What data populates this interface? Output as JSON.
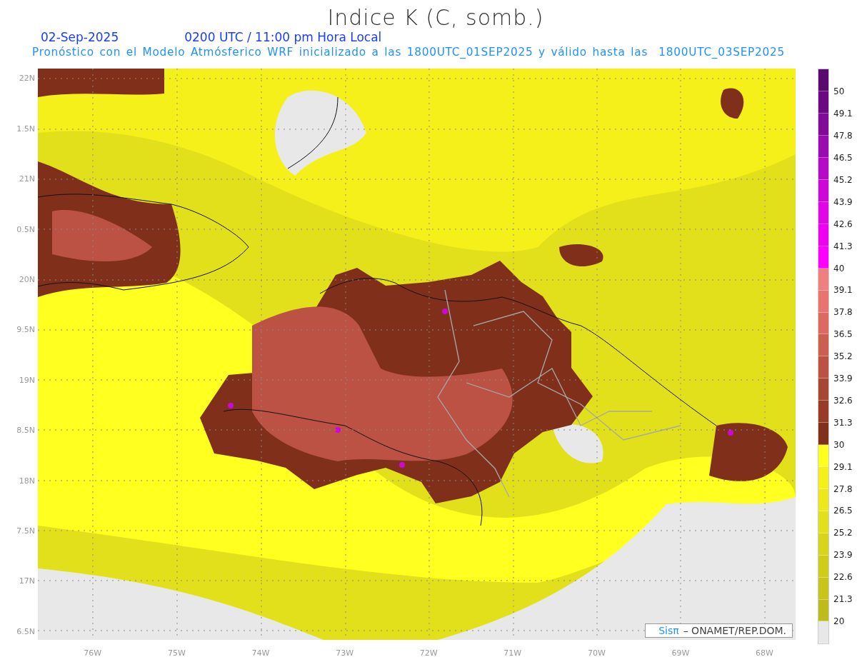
{
  "title": "Indice K (C, somb.)",
  "date": "02-Sep-2025",
  "time": "0200 UTC / 11:00 pm Hora Local",
  "subtitle": "Pronóstico con el Modelo Atmósferico WRF inicializado a las 1800UTC_01SEP2025 y válido hasta las  1800UTC_03SEP2025",
  "y_labels": [
    "22N",
    "1.5N",
    "21N",
    "0.5N",
    "20N",
    "9.5N",
    "19N",
    "8.5N",
    "18N",
    "7.5N",
    "17N",
    "6.5N"
  ],
  "x_labels": [
    "76W",
    "75W",
    "74W",
    "73W",
    "72W",
    "71W",
    "70W",
    "69W",
    "68W"
  ],
  "credit": {
    "brand": "Sisπ",
    "text": "– ONAMET/REP.DOM."
  },
  "legend": {
    "bins": [
      {
        "color": "#5a0a6e"
      },
      {
        "color": "#6c0882"
      },
      {
        "color": "#820a98"
      },
      {
        "color": "#9a0cb0"
      },
      {
        "color": "#b40cc6"
      },
      {
        "color": "#cc08d8"
      },
      {
        "color": "#e006e6"
      },
      {
        "color": "#f000f0"
      },
      {
        "color": "#ff00ff"
      },
      {
        "color": "#f08080"
      },
      {
        "color": "#e87470"
      },
      {
        "color": "#dc6a60"
      },
      {
        "color": "#cc6050"
      },
      {
        "color": "#bc5244"
      },
      {
        "color": "#a84636"
      },
      {
        "color": "#983a28"
      },
      {
        "color": "#80301a"
      },
      {
        "color": "#ffff20"
      },
      {
        "color": "#f6f01a"
      },
      {
        "color": "#ece81a"
      },
      {
        "color": "#e2e01a"
      },
      {
        "color": "#d8d41a"
      },
      {
        "color": "#d0cc1a"
      },
      {
        "color": "#c8c41a"
      },
      {
        "color": "#bebc1a"
      },
      {
        "color": "#e8e8e8"
      }
    ],
    "labels": [
      "50",
      "49.1",
      "47.8",
      "46.5",
      "45.2",
      "43.9",
      "42.6",
      "41.3",
      "40",
      "39.1",
      "37.8",
      "36.5",
      "35.2",
      "33.9",
      "32.6",
      "31.3",
      "30",
      "29.1",
      "27.8",
      "26.5",
      "25.2",
      "23.9",
      "22.6",
      "21.3",
      "20"
    ]
  }
}
